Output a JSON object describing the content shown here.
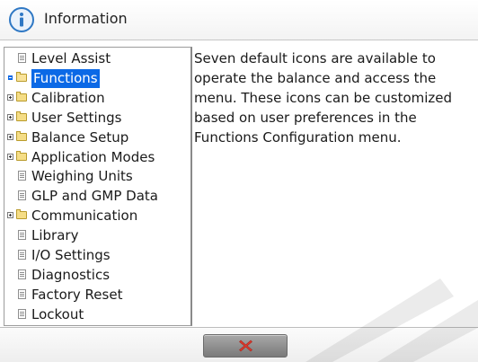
{
  "window": {
    "title": "Information",
    "icon": "info-icon"
  },
  "tree": {
    "items": [
      {
        "label": "Level Assist",
        "icon": "document-icon",
        "expander": ""
      },
      {
        "label": "Functions",
        "icon": "folder-open-icon",
        "expander": "minus",
        "selected": true
      },
      {
        "label": "Calibration",
        "icon": "folder-icon",
        "expander": "plus"
      },
      {
        "label": "User Settings",
        "icon": "folder-icon",
        "expander": "plus"
      },
      {
        "label": "Balance Setup",
        "icon": "folder-icon",
        "expander": "plus"
      },
      {
        "label": "Application Modes",
        "icon": "folder-icon",
        "expander": "plus"
      },
      {
        "label": "Weighing Units",
        "icon": "document-icon",
        "expander": ""
      },
      {
        "label": "GLP and GMP Data",
        "icon": "document-icon",
        "expander": ""
      },
      {
        "label": "Communication",
        "icon": "folder-icon",
        "expander": "plus"
      },
      {
        "label": "Library",
        "icon": "document-icon",
        "expander": ""
      },
      {
        "label": "I/O Settings",
        "icon": "document-icon",
        "expander": ""
      },
      {
        "label": "Diagnostics",
        "icon": "document-icon",
        "expander": ""
      },
      {
        "label": "Factory Reset",
        "icon": "document-icon",
        "expander": ""
      },
      {
        "label": "Lockout",
        "icon": "document-icon",
        "expander": ""
      }
    ]
  },
  "description": {
    "lines": [
      "Seven default icons are available to",
      "operate the balance and access the",
      "menu. These icons can be customized",
      "based on user preferences in the",
      "Functions Configuration menu."
    ]
  },
  "footer": {
    "close_icon": "close-icon",
    "accent": "#e23b2e"
  },
  "colors": {
    "selection": "#0b69e6",
    "title_text": "#222222"
  }
}
